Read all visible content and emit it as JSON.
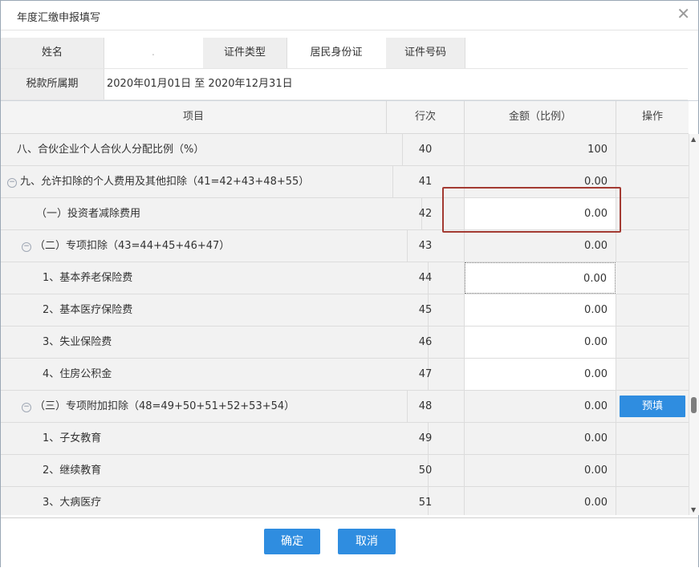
{
  "window": {
    "title": "年度汇缴申报填写"
  },
  "info": {
    "name_label": "姓名",
    "name_value": ".",
    "id_type_label": "证件类型",
    "id_type_value": "居民身份证",
    "id_no_label": "证件号码",
    "id_no_value": "",
    "period_label": "税款所属期",
    "period_value": "2020年01月01日 至 2020年12月31日"
  },
  "table": {
    "headers": {
      "item": "项目",
      "row": "行次",
      "amount": "金额（比例）",
      "op": "操作"
    },
    "rows": [
      {
        "item": "八、合伙企业个人合伙人分配比例（%）",
        "row": "40",
        "amount": "100"
      },
      {
        "item": "九、允许扣除的个人费用及其他扣除（41=42+43+48+55）",
        "row": "41",
        "amount": "0.00"
      },
      {
        "item": "（一）投资者减除费用",
        "row": "42",
        "amount": "0.00"
      },
      {
        "item": "（二）专项扣除（43=44+45+46+47）",
        "row": "43",
        "amount": "0.00"
      },
      {
        "item": "1、基本养老保险费",
        "row": "44",
        "amount": "0.00"
      },
      {
        "item": "2、基本医疗保险费",
        "row": "45",
        "amount": "0.00"
      },
      {
        "item": "3、失业保险费",
        "row": "46",
        "amount": "0.00"
      },
      {
        "item": "4、住房公积金",
        "row": "47",
        "amount": "0.00"
      },
      {
        "item": "（三）专项附加扣除（48=49+50+51+52+53+54）",
        "row": "48",
        "amount": "0.00",
        "op": "预填"
      },
      {
        "item": "1、子女教育",
        "row": "49",
        "amount": "0.00"
      },
      {
        "item": "2、继续教育",
        "row": "50",
        "amount": "0.00"
      },
      {
        "item": "3、大病医疗",
        "row": "51",
        "amount": "0.00"
      }
    ]
  },
  "footer": {
    "confirm": "确定",
    "cancel": "取消"
  },
  "icons": {
    "close": "close-icon",
    "collapse": "collapse-circle-icon"
  },
  "colors": {
    "accent": "#2f8de0",
    "highlight_border": "#a33a32"
  }
}
